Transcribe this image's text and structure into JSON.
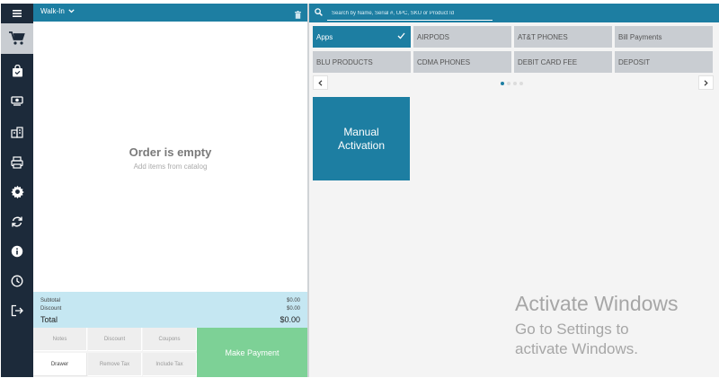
{
  "order": {
    "customer": "Walk-In",
    "empty_title": "Order is empty",
    "empty_subtitle": "Add items from catalog",
    "totals": {
      "subtotal_label": "Subtotal",
      "subtotal_value": "$0.00",
      "discount_label": "Discount",
      "discount_value": "$0.00",
      "total_label": "Total",
      "total_value": "$0.00"
    },
    "actions": {
      "notes": "Notes",
      "discount": "Discount",
      "coupons": "Coupons",
      "drawer": "Drawer",
      "remove_tax": "Remove Tax",
      "include_tax": "Include Tax",
      "make_payment": "Make Payment"
    }
  },
  "nav": {
    "items": [
      "menu-icon",
      "cart-icon",
      "bag-icon",
      "cash-icon",
      "store-icon",
      "printer-icon",
      "gear-icon",
      "sync-icon",
      "info-icon",
      "clock-icon",
      "logout-icon"
    ],
    "active": "cart-icon"
  },
  "search": {
    "placeholder": "Search by Name, Serial #, UPC, SKU or Product Id"
  },
  "catalog": {
    "categories": [
      {
        "label": "Apps",
        "selected": true
      },
      {
        "label": "AIRPODS",
        "selected": false
      },
      {
        "label": "AT&T PHONES",
        "selected": false
      },
      {
        "label": "Bill Payments",
        "selected": false
      },
      {
        "label": "BLU PRODUCTS",
        "selected": false
      },
      {
        "label": "CDMA PHONES",
        "selected": false
      },
      {
        "label": "DEBIT CARD FEE",
        "selected": false
      },
      {
        "label": "DEPOSIT",
        "selected": false
      }
    ],
    "pages": 4,
    "current_page": 1,
    "tile": "Manual Activation"
  },
  "watermark": {
    "title": "Activate Windows",
    "subtitle": "Go to Settings to activate Windows."
  },
  "colors": {
    "brand": "#1d7ea2",
    "nav": "#1c2a3a",
    "pay": "#7dd196",
    "totals": "#c5e7f2"
  }
}
